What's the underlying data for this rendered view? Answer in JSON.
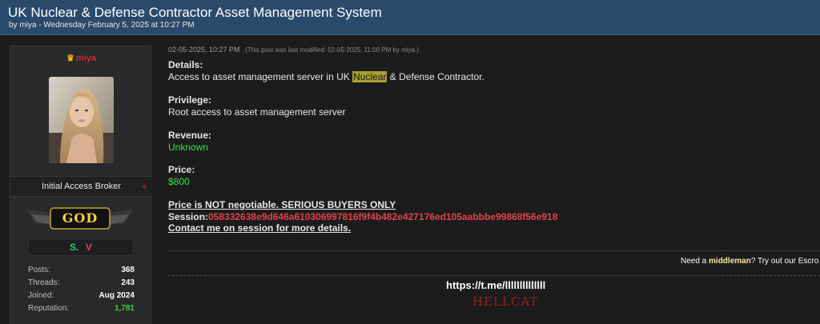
{
  "thread": {
    "title": "UK Nuclear & Defense Contractor Asset Management System",
    "byline": "by miya - Wednesday February 5, 2025 at 10:27 PM"
  },
  "user": {
    "username": "miya",
    "title": "Initial Access Broker",
    "rank": "GOD",
    "stats": [
      {
        "label": "Posts:",
        "value": "368"
      },
      {
        "label": "Threads:",
        "value": "243"
      },
      {
        "label": "Joined:",
        "value": "Aug 2024"
      },
      {
        "label": "Reputation:",
        "value": "1,781"
      }
    ],
    "awards": [
      "S.",
      "V"
    ],
    "colors": {
      "username": "#d12b2b",
      "reputation": "#3fcf3f",
      "rank_gold": "#f7d234"
    }
  },
  "post": {
    "date": "02-05-2025, 10:27 PM",
    "modified": "(This post was last modified: 02-05-2025, 11:00 PM by miya.)",
    "details_label": "Details:",
    "details_pre": "Access to asset management server in UK ",
    "details_highlight": "Nuclear",
    "details_post": " & Defense Contractor.",
    "privilege_label": "Privilege:",
    "privilege_value": "Root access to asset management server",
    "revenue_label": "Revenue:",
    "revenue_value": "Unknown",
    "price_label": "Price:",
    "price_value": "$800",
    "negotiable_notice": "Price is NOT negotiable. SERIOUS BUYERS ONLY",
    "session_label": "Session:",
    "session_id": "058332638e9d646a610306997816f9f4b482e427176ed105aabbbe99868f56e918",
    "contact_note": "Contact me on session for more details."
  },
  "escrow": {
    "pre": "Need a ",
    "bold": "middleman",
    "post": "? Try out our Escro"
  },
  "signature": {
    "link": "https://t.me/llllllllllllll",
    "name": "HELLCAT"
  },
  "colors": {
    "header_bg": "#2a4a6b",
    "page_bg": "#1c1c1c",
    "green": "#3de03d",
    "red": "#e0434c",
    "highlight": "#a8a032"
  }
}
